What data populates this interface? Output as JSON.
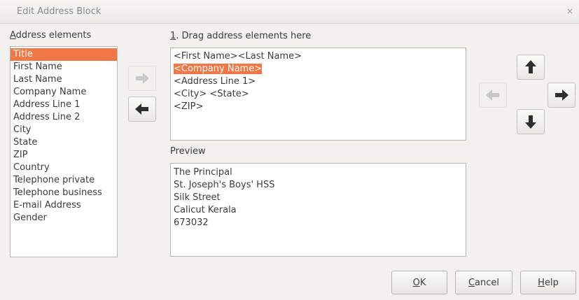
{
  "window": {
    "title": "Edit Address Block",
    "close_glyph": "×"
  },
  "address_elements": {
    "label_accel": "A",
    "label_rest": "ddress elements",
    "items": [
      {
        "label": "Title",
        "selected": true
      },
      {
        "label": "First Name"
      },
      {
        "label": "Last Name"
      },
      {
        "label": "Company Name"
      },
      {
        "label": "Address Line 1"
      },
      {
        "label": "Address Line 2"
      },
      {
        "label": "City"
      },
      {
        "label": "State"
      },
      {
        "label": "ZIP"
      },
      {
        "label": "Country"
      },
      {
        "label": "Telephone private"
      },
      {
        "label": "Telephone business"
      },
      {
        "label": "E-mail Address"
      },
      {
        "label": "Gender"
      }
    ]
  },
  "drag_area": {
    "label_accel": "1",
    "label_rest": ". Drag address elements here",
    "lines": [
      "<First Name><Last Name>",
      "<Company Name>",
      "<Address Line 1>",
      "<City> <State>",
      "<ZIP>"
    ],
    "highlighted_line": "<Company Name>"
  },
  "preview": {
    "label": "Preview",
    "lines": [
      "The Principal",
      "St. Joseph's Boys' HSS",
      "Silk Street",
      "Calicut  Kerala",
      "673032"
    ]
  },
  "buttons": {
    "ok": {
      "accel": "O",
      "rest": "K"
    },
    "cancel": {
      "accel": "C",
      "rest": "ancel"
    },
    "help": {
      "accel": "H",
      "rest": "elp"
    }
  },
  "icons": {
    "insert": "arrow-right-icon",
    "remove": "arrow-left-icon",
    "up": "arrow-up-icon",
    "down": "arrow-down-icon",
    "left": "arrow-left-icon",
    "right": "arrow-right-icon"
  },
  "colors": {
    "selection": "#f07746",
    "arrow_enabled": "#2e2e2e",
    "arrow_disabled": "#c8c8c8"
  }
}
